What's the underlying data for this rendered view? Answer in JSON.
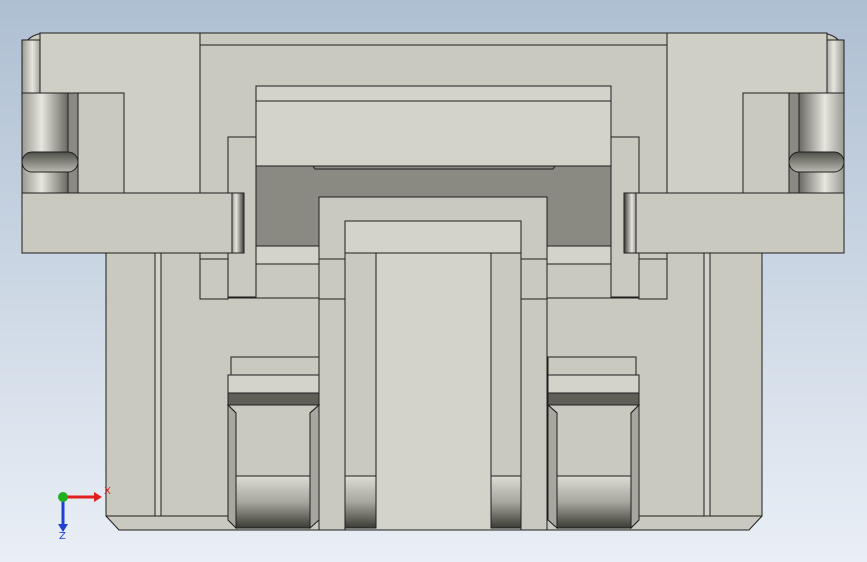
{
  "viewport": {
    "background_top": "#aebfd2",
    "background_bottom": "#eaeff6"
  },
  "model": {
    "face_color": "#c9c9c0",
    "face_light_color": "#d3d3ca",
    "shadow_color": "#8a8a82",
    "dark_color": "#5f5f58",
    "edge_color": "#1e1e1e"
  },
  "triad": {
    "x_label": "X",
    "z_label": "Z",
    "x_color": "#e02020",
    "y_color": "#20b020",
    "z_color": "#2040d0"
  }
}
